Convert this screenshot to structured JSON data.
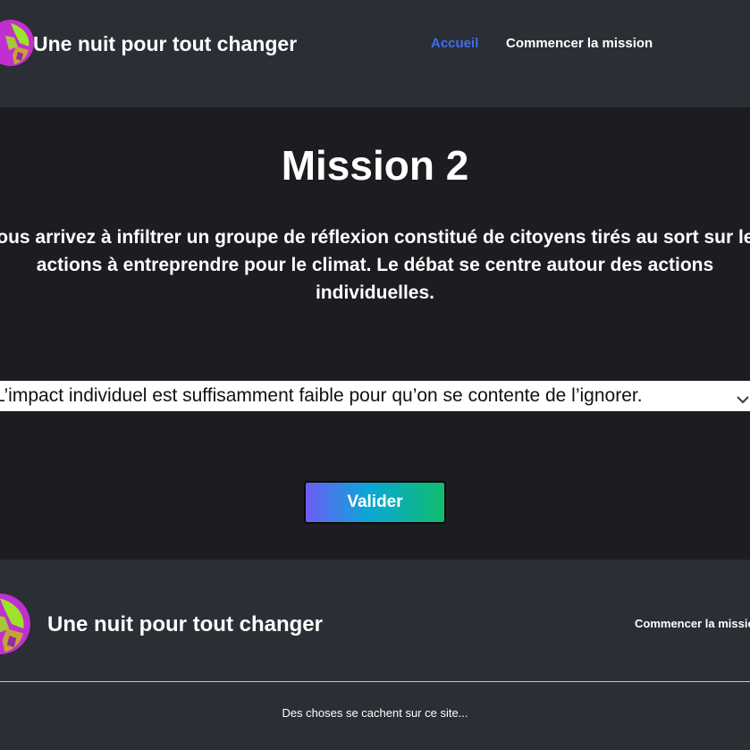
{
  "header": {
    "logo_icon": "planet-logo-icon",
    "site_title": "Une nuit pour tout changer",
    "nav": {
      "home_label": "Accueil",
      "mission_label": "Commencer la mission"
    }
  },
  "main": {
    "title": "Mission 2",
    "text": "Vous arrivez à infiltrer un groupe de réflexion constitué de citoyens tirés au sort sur les actions à entreprendre pour le climat. Le débat se centre autour des actions individuelles.",
    "select": {
      "selected_value": "L’impact individuel est suffisamment faible pour qu’on se contente de l’ignorer.",
      "arrow_icon": "chevron-down-icon"
    },
    "validate_label": "Valider"
  },
  "footer": {
    "logo_icon": "planet-logo-icon",
    "site_title": "Une nuit pour tout changer",
    "nav_label": "Commencer la mission",
    "note": "Des choses se cachent sur ce site..."
  },
  "colors": {
    "header_bg": "#2b2e34",
    "main_bg": "#1c1d20",
    "active_link": "#3b6ff0",
    "button_gradient": [
      "#6d5cf6",
      "#0aa7d6",
      "#10bc6e"
    ]
  }
}
